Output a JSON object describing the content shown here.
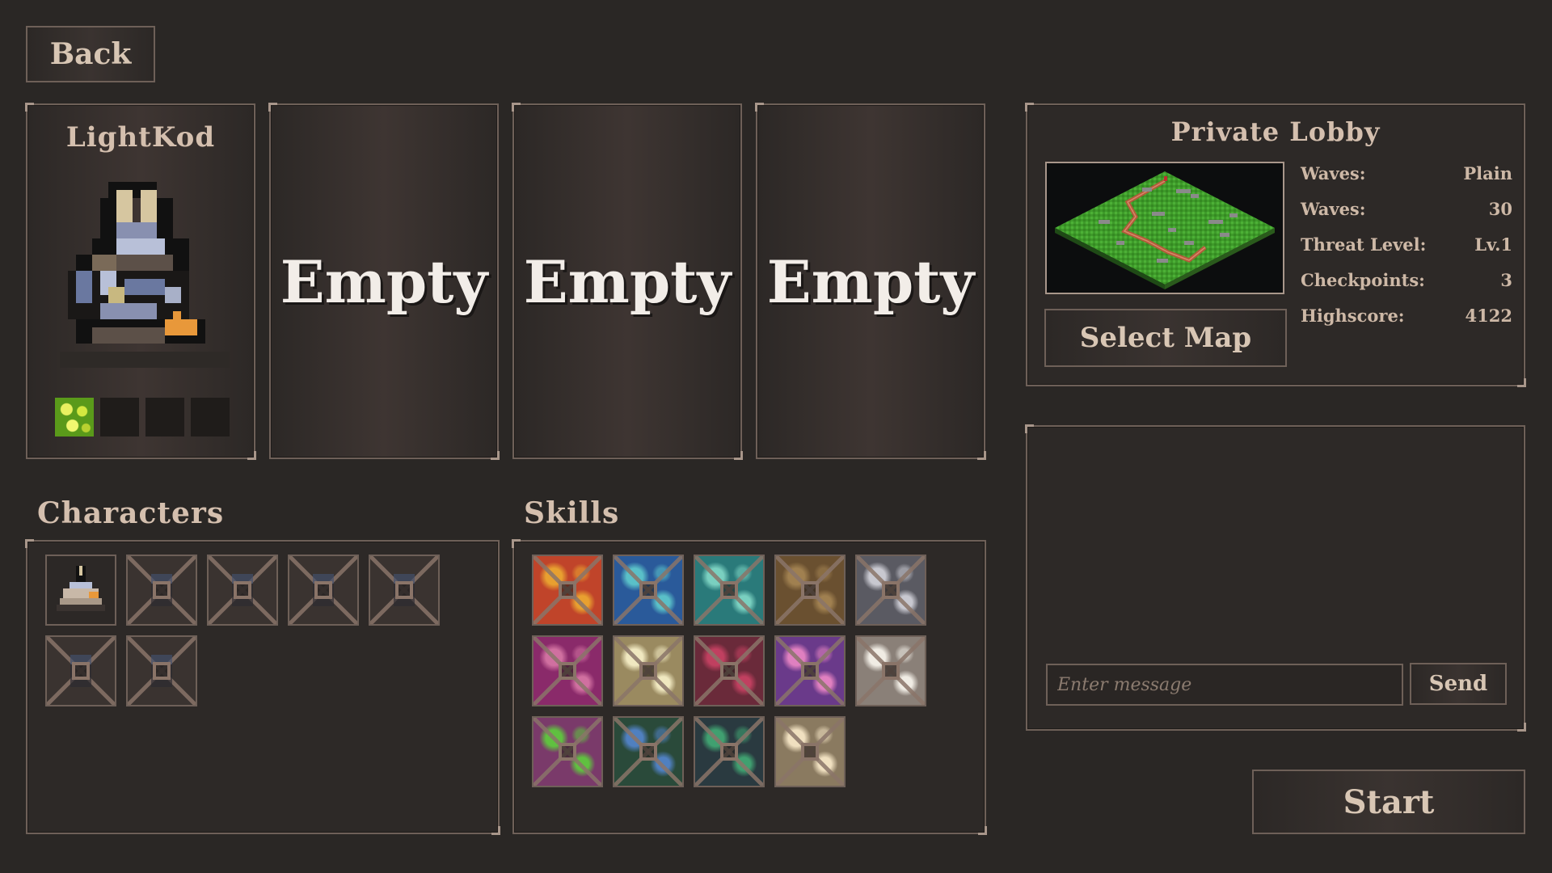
{
  "back_button": {
    "label": "Back"
  },
  "player_slots": [
    {
      "name": "LightKod"
    },
    {
      "empty_label": "Empty"
    },
    {
      "empty_label": "Empty"
    },
    {
      "empty_label": "Empty"
    }
  ],
  "lobby": {
    "title": "Private Lobby",
    "select_map_label": "Select Map",
    "stats": [
      {
        "label": "Waves:",
        "value": "Plain"
      },
      {
        "label": "Waves:",
        "value": "30"
      },
      {
        "label": "Threat Level:",
        "value": "Lv.1"
      },
      {
        "label": "Checkpoints:",
        "value": "3"
      },
      {
        "label": "Highscore:",
        "value": "4122"
      }
    ]
  },
  "chat": {
    "input_placeholder": "Enter message",
    "send_label": "Send"
  },
  "start_button": {
    "label": "Start"
  },
  "characters": {
    "label": "Characters",
    "tiles": [
      {
        "state": "unlocked",
        "icon": "knight-character-icon"
      },
      {
        "state": "locked",
        "icon": "locked-character-icon"
      },
      {
        "state": "locked",
        "icon": "locked-character-icon"
      },
      {
        "state": "locked",
        "icon": "locked-character-icon"
      },
      {
        "state": "locked",
        "icon": "locked-character-icon"
      },
      {
        "state": "locked",
        "icon": "locked-character-icon"
      },
      {
        "state": "locked",
        "icon": "locked-character-icon"
      }
    ]
  },
  "skills": {
    "label": "Skills",
    "tiles": [
      {
        "color": "#c0442a",
        "accent": "#e8a030"
      },
      {
        "color": "#2a5a9a",
        "accent": "#5ac0c8"
      },
      {
        "color": "#2a7a7a",
        "accent": "#7ad0c0"
      },
      {
        "color": "#6a5030",
        "accent": "#a08050"
      },
      {
        "color": "#5a5a62",
        "accent": "#c8c8d0"
      },
      {
        "color": "#8a2a6a",
        "accent": "#d070a0"
      },
      {
        "color": "#9a8a60",
        "accent": "#f0e8c0"
      },
      {
        "color": "#6a2a3a",
        "accent": "#c04060"
      },
      {
        "color": "#6a3a8a",
        "accent": "#e080c0"
      },
      {
        "color": "#8a8078",
        "accent": "#f0ece4"
      },
      {
        "color": "#7a3a6a",
        "accent": "#60c040"
      },
      {
        "color": "#2a4a3a",
        "accent": "#5080c0"
      },
      {
        "color": "#2a3a40",
        "accent": "#40a070"
      },
      {
        "color": "#8a7a60",
        "accent": "#f0e0c0"
      }
    ]
  }
}
